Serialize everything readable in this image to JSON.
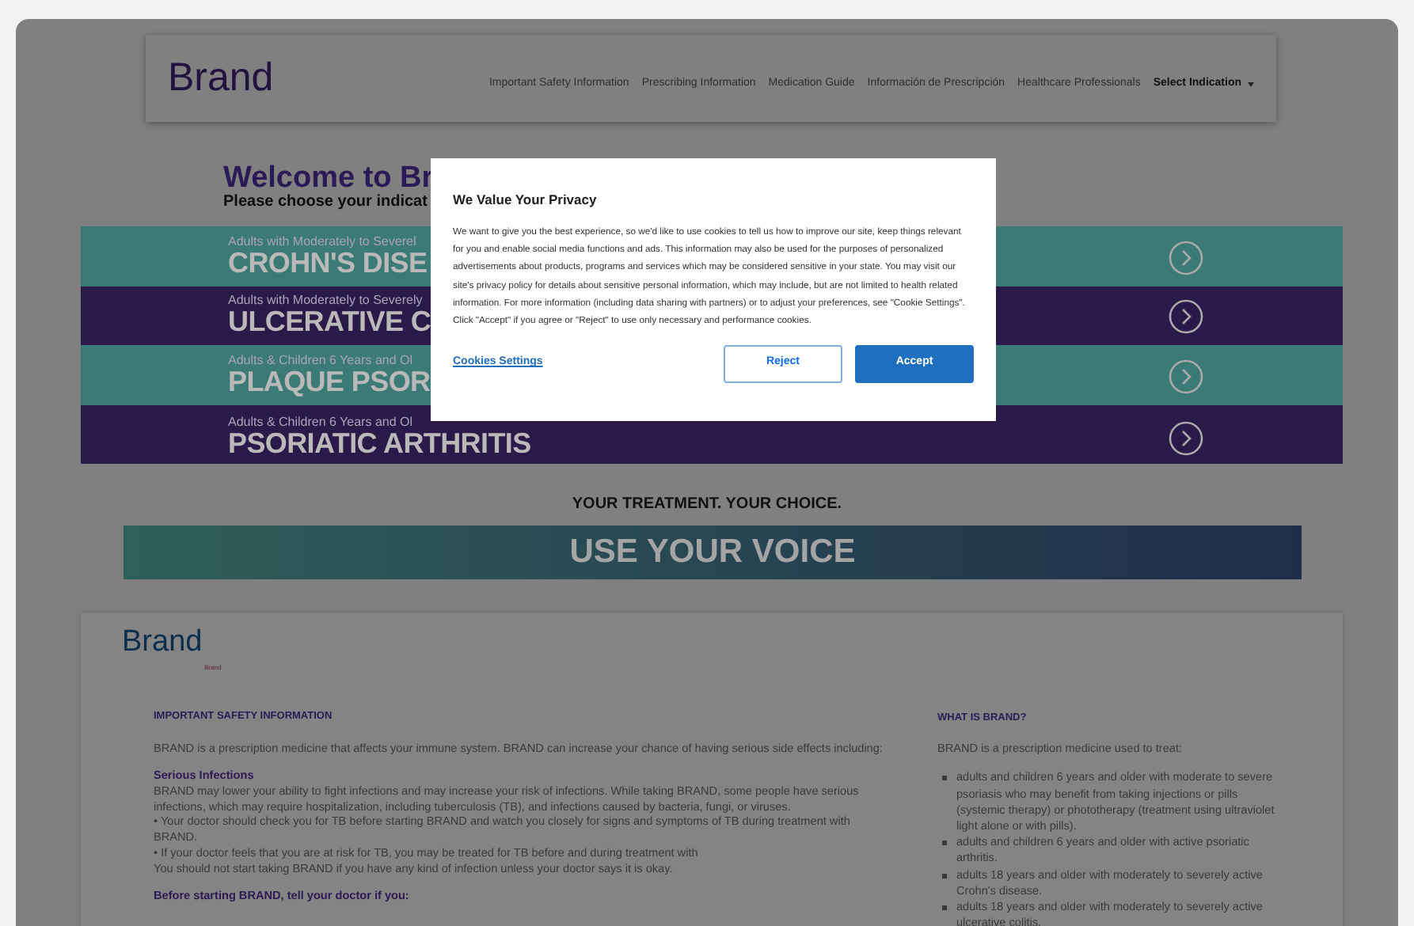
{
  "header": {
    "logo": "Brand",
    "links": [
      {
        "label": "Important Safety Information"
      },
      {
        "label": "Prescribing Information"
      },
      {
        "label": "Medication Guide"
      },
      {
        "label": "Información de Prescripción"
      },
      {
        "label": "Healthcare Professionals"
      }
    ],
    "dropdown": {
      "label": "Select Indication"
    }
  },
  "welcome": {
    "title": "Welcome to Br",
    "subtitle": "Please choose your indicat"
  },
  "indications": [
    {
      "subtitle": "Adults with Moderately to Severel",
      "title": "CROHN'S DISE",
      "color": "#3c7b75"
    },
    {
      "subtitle": "Adults with Moderately to Severely",
      "title": "ULCERATIVE C",
      "color": "#2a1a4a"
    },
    {
      "subtitle": "Adults & Children 6 Years and Ol",
      "title": "PLAQUE PSOR",
      "color": "#3c7b75"
    },
    {
      "subtitle": "Adults & Children 6 Years and Ol",
      "title": "PSORIATIC ARTHRITIS",
      "color": "#2a1a4a"
    }
  ],
  "tagline": "YOUR TREATMENT. YOUR CHOICE.",
  "voice_banner": "USE YOUR VOICE",
  "isi": {
    "logo": "Brand",
    "logo_sub": "Brand",
    "left": [
      {
        "kind": "heading",
        "text": "IMPORTANT SAFETY INFORMATION"
      },
      {
        "kind": "para",
        "text": "BRAND is a prescription medicine that affects your immune system. BRAND can increase your chance of having serious side effects including:"
      },
      {
        "kind": "subheading",
        "text": "Serious Infections"
      },
      {
        "kind": "line",
        "text": "BRAND may lower your ability to fight infections and may increase your risk of infections. While taking BRAND, some people have serious infections, which may require hospitalization, including tuberculosis (TB), and infections caused by bacteria, fungi, or viruses."
      },
      {
        "kind": "line",
        "text": "•  Your doctor should check you for TB before starting BRAND and watch you closely for signs and symptoms of TB during treatment with BRAND."
      },
      {
        "kind": "line",
        "text": "•  If your doctor feels that you are at risk for TB, you may be treated for TB before and during treatment with"
      },
      {
        "kind": "para",
        "text": "You should not start taking BRAND if you have any kind of infection unless your doctor says it is okay."
      },
      {
        "kind": "subheading",
        "text": "Before starting BRAND, tell your doctor if you:"
      }
    ],
    "right": [
      {
        "kind": "heading",
        "text": "WHAT IS BRAND?"
      },
      {
        "kind": "para",
        "text": "BRAND is a prescription medicine used to treat:"
      },
      {
        "kind": "bullet",
        "text": "adults and children 6 years and older with moderate to severe psoriasis who may benefit from taking injections or pills (systemic therapy) or phototherapy (treatment using ultraviolet light alone or with pills)."
      },
      {
        "kind": "bullet",
        "text": "adults and children 6 years and older with active psoriatic arthritis."
      },
      {
        "kind": "bullet",
        "text": "adults 18 years and older with moderately to severely active Crohn's disease."
      },
      {
        "kind": "bullet",
        "text": "adults 18 years and older with moderately to severely active ulcerative colitis."
      }
    ]
  },
  "cookie_dialog": {
    "title": "We Value Your Privacy",
    "body": "We want to give you the best experience, so we'd like to use cookies to tell us how to improve our site, keep things relevant for you and enable social media functions and ads. This information may also be used for the purposes of personalized advertisements about products, programs and services which may be considered sensitive in your state. You may visit our site's privacy policy for details about sensitive personal information, which may include, but are not limited to health related information. For more information (including data sharing with partners) or to adjust your preferences, see \"Cookie Settings\". Click \"Accept\" if you agree or \"Reject\" to use only necessary and performance cookies.",
    "settings_link": "Cookies Settings",
    "buttons": [
      {
        "label": "Reject",
        "kind": "outline"
      },
      {
        "label": "Accept",
        "kind": "primary"
      }
    ]
  }
}
